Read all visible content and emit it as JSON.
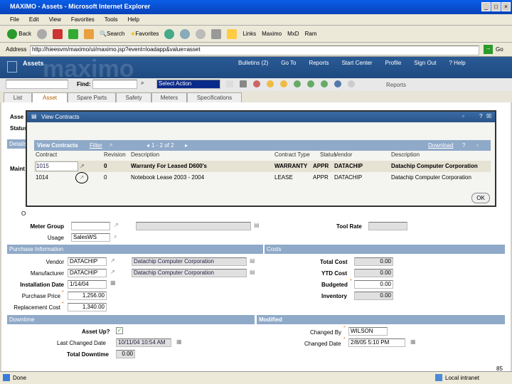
{
  "window": {
    "title": "MAXIMO - Assets - Microsoft Internet Explorer"
  },
  "menu": [
    "File",
    "Edit",
    "View",
    "Favorites",
    "Tools",
    "Help"
  ],
  "toolbar": {
    "back": "Back",
    "search": "Search",
    "favorites": "Favorites",
    "links": "Links",
    "link1": "Maximo",
    "link2": "MxD",
    "link3": "Ram"
  },
  "address": {
    "label": "Address",
    "url": "http://hieesvm/maximo/ui/maximo.jsp?event=loadapp&value=asset",
    "go": "Go"
  },
  "app": {
    "title": "Assets",
    "logo": "maximo",
    "nav": [
      "Bulletins (2)",
      "Go To",
      "Reports",
      "Start Center",
      "Profile",
      "Sign Out",
      "? Help"
    ]
  },
  "apptool": {
    "find": "Find:",
    "action": "Select Action",
    "reports": "Reports"
  },
  "tabs": [
    "List",
    "Asset",
    "Spare Parts",
    "Safety",
    "Meters",
    "Specifications"
  ],
  "bg": {
    "asset": "Asse",
    "status": "Status",
    "details": "Details",
    "maint": "Maint",
    "o": "O"
  },
  "dialog": {
    "title": "View Contracts",
    "table_title": "View Contracts",
    "filter": "Filter",
    "paging": "1 - 2 of 2",
    "download": "Download",
    "ok": "OK",
    "columns": [
      "Contract",
      "Revision",
      "Description",
      "Contract Type",
      "Status",
      "Vendor",
      "Description"
    ],
    "rows": [
      {
        "contract": "1015",
        "revision": "0",
        "description": "Warranty For Leased D600's",
        "type": "WARRANTY",
        "status": "APPR",
        "vendor": "DATACHIP",
        "vendor_desc": "Datachip Computer Corporation"
      },
      {
        "contract": "1014",
        "revision": "0",
        "description": "Notebook Lease 2003 - 2004",
        "type": "LEASE",
        "status": "APPR",
        "vendor": "DATACHIP",
        "vendor_desc": "Datachip Computer Corporation"
      }
    ]
  },
  "meter": {
    "meter_group": "Meter Group",
    "usage": "Usage",
    "usage_value": "SalesWS",
    "tool_rate": "Tool Rate"
  },
  "purchase": {
    "title": "Purchase Information",
    "vendor": "Vendor",
    "vendor_value": "DATACHIP",
    "vendor_desc": "Datachip Computer Corporation",
    "manufacturer": "Manufacturer",
    "manufacturer_value": "DATACHIP",
    "manufacturer_desc": "Datachip Computer Corporation",
    "install_date": "Installation Date",
    "install_value": "1/14/04",
    "purchase_price": "Purchase Price",
    "purchase_value": "1,256.00",
    "replacement": "Replacement Cost",
    "replacement_value": "1,340.00"
  },
  "costs": {
    "title": "Costs",
    "total": "Total Cost",
    "total_value": "0.00",
    "ytd": "YTD Cost",
    "ytd_value": "0.00",
    "budgeted": "Budgeted",
    "budgeted_value": "0.00",
    "inventory": "Inventory",
    "inventory_value": "0.00"
  },
  "downtime": {
    "title": "Downtime",
    "asset_up": "Asset Up?",
    "last_changed": "Last Changed Date",
    "last_changed_value": "10/11/04 10:54 AM",
    "total": "Total Downtime",
    "total_value": "0.00"
  },
  "modified": {
    "title": "Modified",
    "changed_by": "Changed By",
    "changed_by_value": "WILSON",
    "changed_date": "Changed Date",
    "changed_date_value": "2/8/05 5:10 PM"
  },
  "statusbar": {
    "text": "Done",
    "zone": "Local intranet",
    "page": "85"
  }
}
